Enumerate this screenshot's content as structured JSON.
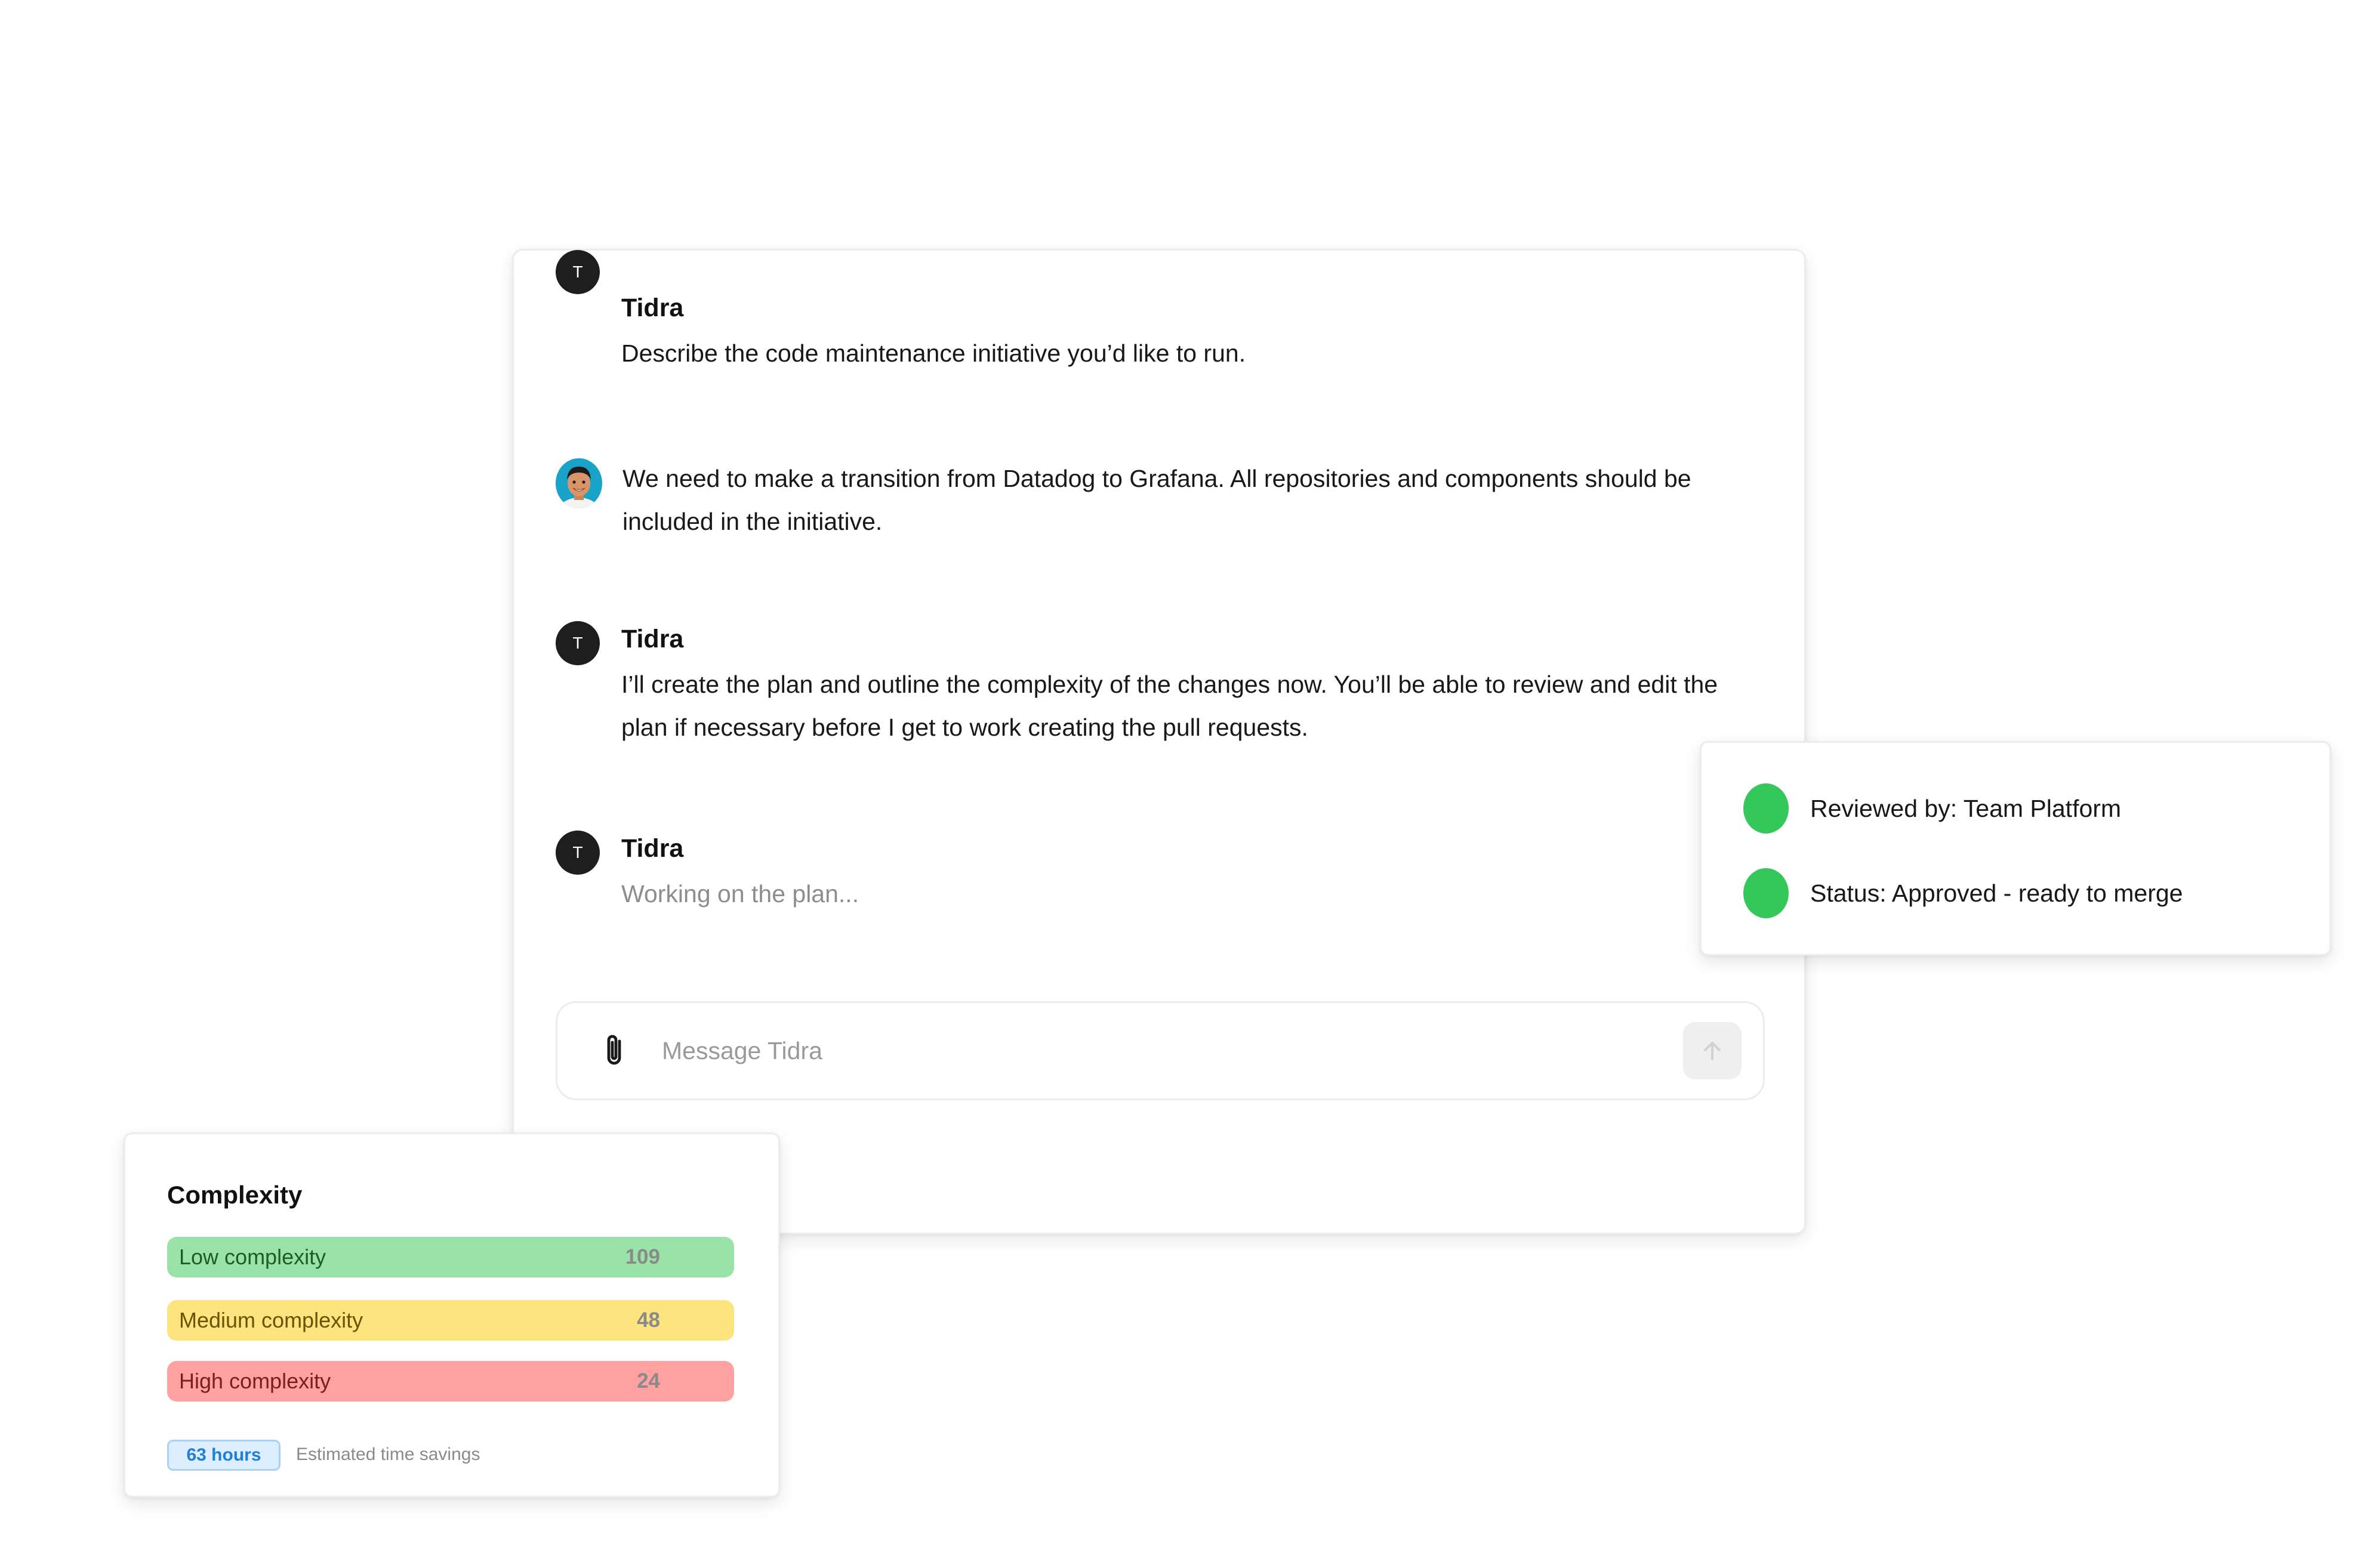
{
  "chat": {
    "messages": [
      {
        "sender": "Tidra",
        "avatar_initial": "T",
        "text": "Describe the code maintenance initiative you’d like to run."
      },
      {
        "sender": "user",
        "text": "We need to make a transition from Datadog to Grafana. All repositories and components should be included in the initiative."
      },
      {
        "sender": "Tidra",
        "avatar_initial": "T",
        "text": "I’ll create the plan and outline the complexity of the changes now. You’ll be able to review and edit the plan if necessary before I get to work creating the pull requests."
      },
      {
        "sender": "Tidra",
        "avatar_initial": "T",
        "text": "Working on the plan..."
      }
    ],
    "composer": {
      "placeholder": "Message Tidra",
      "value": "",
      "attach_icon": "paperclip-icon",
      "send_icon": "arrow-up-icon"
    }
  },
  "review": {
    "items": [
      {
        "text": "Reviewed by: Team Platform",
        "status_color": "#34c759"
      },
      {
        "text": "Status: Approved - ready to merge",
        "status_color": "#34c759"
      }
    ]
  },
  "complexity": {
    "title": "Complexity",
    "levels": [
      {
        "label": "Low complexity",
        "value": "109",
        "color": "#9ae3a8",
        "text_color": "#1f5a2c"
      },
      {
        "label": "Medium complexity",
        "value": "48",
        "color": "#fde47f",
        "text_color": "#6a5200"
      },
      {
        "label": "High complexity",
        "value": "24",
        "color": "#ffa1a1",
        "text_color": "#7a1f1f"
      }
    ],
    "hours": "63 hours",
    "hours_caption": "Estimated time savings"
  },
  "colors": {
    "tidra_avatar": "#1e1e1e",
    "status_green": "#34c759",
    "badge_blue": "#1f7fd6"
  }
}
